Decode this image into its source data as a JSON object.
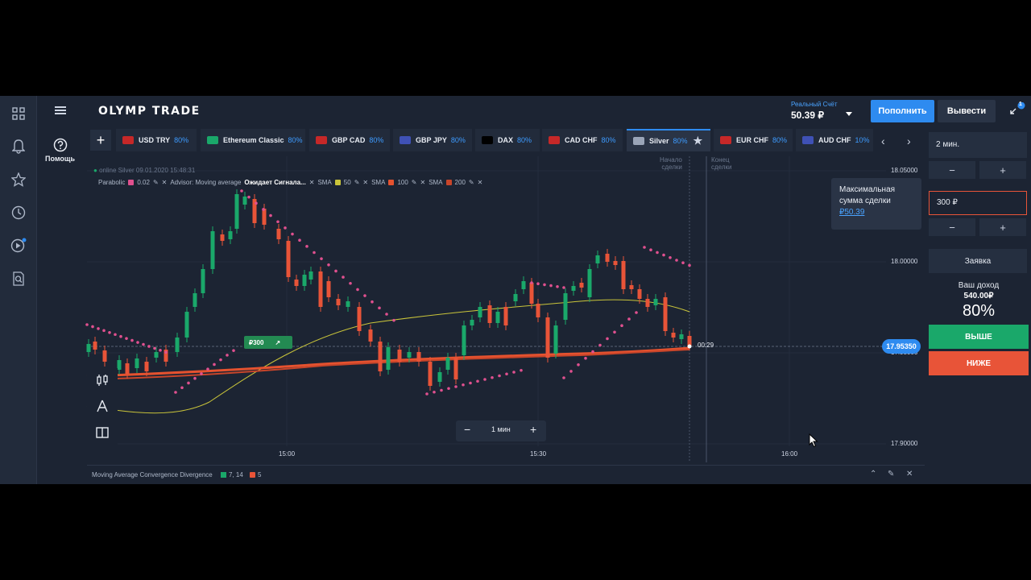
{
  "header": {
    "logo": "OLYMP TRADE",
    "account_label": "Реальный Счёт",
    "balance": "50.39 ₽",
    "deposit_label": "Пополнить",
    "withdraw_label": "Вывести",
    "notification_count": "1"
  },
  "sidebar": {
    "help_label": "Помощь",
    "icons": [
      "grid-icon",
      "bell-icon",
      "star-icon",
      "clock-icon",
      "play-icon",
      "search-document-icon"
    ]
  },
  "tabs": [
    {
      "name": "USD TRY",
      "pct": "80%"
    },
    {
      "name": "Ethereum Classic",
      "pct": "80%"
    },
    {
      "name": "GBP CAD",
      "pct": "80%"
    },
    {
      "name": "GBP JPY",
      "pct": "80%"
    },
    {
      "name": "DAX",
      "pct": "80%"
    },
    {
      "name": "CAD CHF",
      "pct": "80%"
    },
    {
      "name": "Silver",
      "pct": "80%",
      "active": true
    },
    {
      "name": "EUR CHF",
      "pct": "80%"
    },
    {
      "name": "AUD CHF",
      "pct": "10%"
    }
  ],
  "chart": {
    "info": "online Silver 09.01.2020 15:48:31",
    "indicators": {
      "parabolic": "Parabolic",
      "parabolic_val": "0.02",
      "advisor": "Advisor: Moving average",
      "advisor_status": "Ожидает Сигнала...",
      "sma1": "SMA",
      "sma1_val": "50",
      "sma2": "SMA",
      "sma2_val": "100",
      "sma3": "SMA",
      "sma3_val": "200"
    },
    "start_label_1": "Начало",
    "start_label_2": "сделки",
    "end_label_1": "Конец",
    "end_label_2": "сделки",
    "price_labels": [
      "18.05000",
      "18.00000",
      "17.95000",
      "17.90000"
    ],
    "time_labels": [
      "15:00",
      "15:30",
      "16:00"
    ],
    "current_price": "17.95350",
    "timer": "00:29",
    "trade_label": "₽300",
    "zoom_label": "1 мин",
    "colors": {
      "up": "#1aa86a",
      "down": "#e85438",
      "parabolic": "#e0508f",
      "sma50": "#c9c43a",
      "sma100": "#e5522f",
      "sma200": "#c8452a"
    }
  },
  "bottom": {
    "macd_label": "Moving Average Convergence Divergence",
    "macd_val1": "7, 14",
    "macd_val2": "5"
  },
  "panel": {
    "duration": "2 мин.",
    "amount": "300 ₽",
    "max_sum_line1": "Максимальная",
    "max_sum_line2": "сумма сделки",
    "max_sum_value": "₽50.39",
    "order_label": "Заявка",
    "income_label": "Ваш доход",
    "income_value": "540.00₽",
    "income_pct": "80%",
    "up_label": "ВЫШЕ",
    "down_label": "НИЖЕ"
  }
}
